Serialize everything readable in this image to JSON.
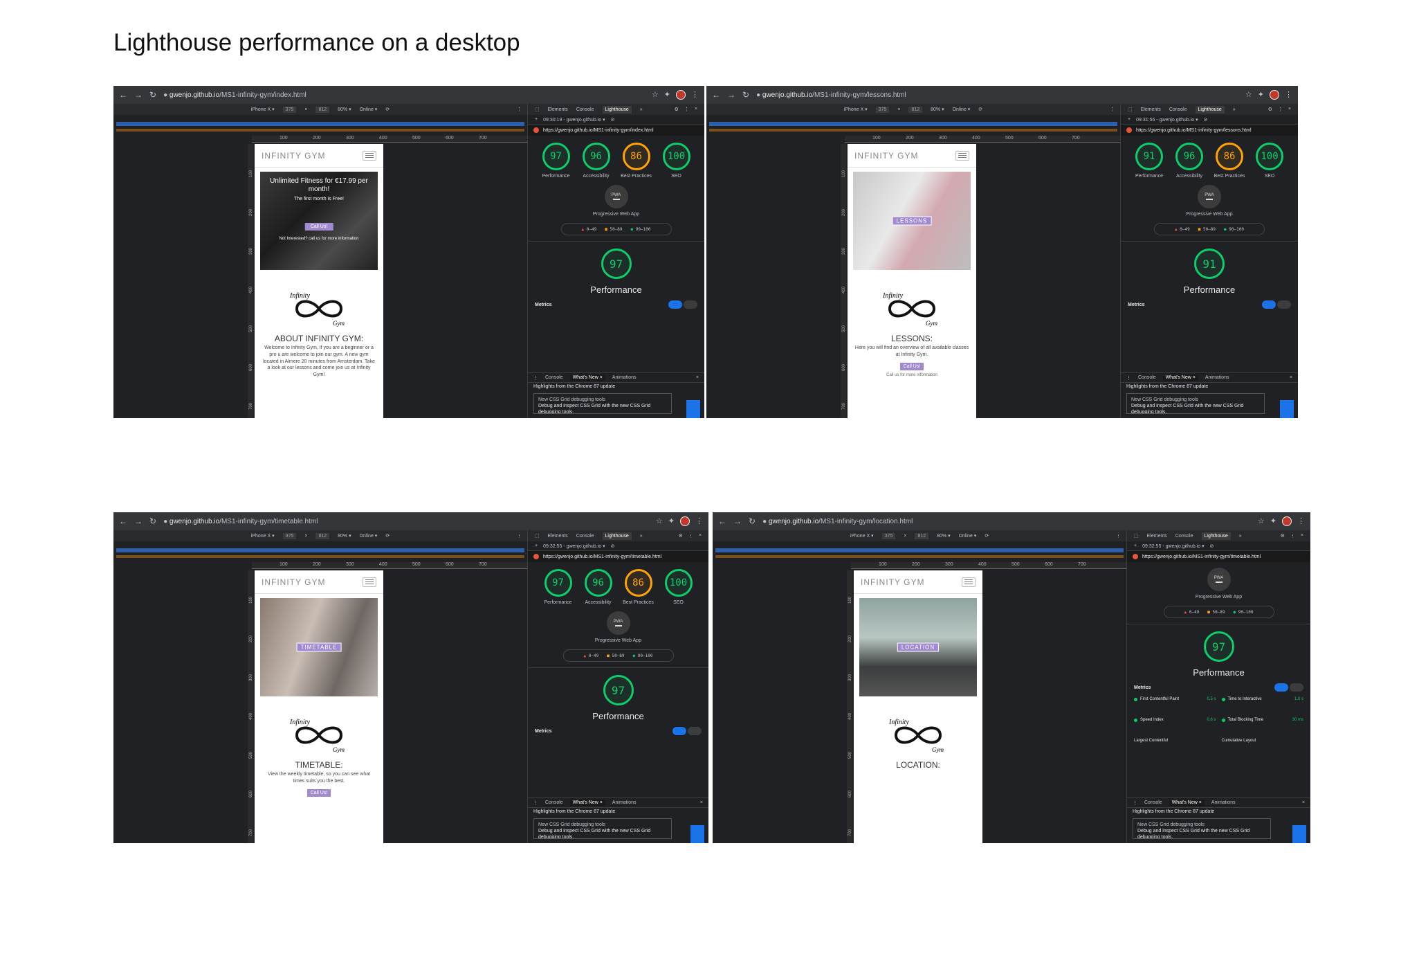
{
  "page_title": "Lighthouse performance on a desktop",
  "shots": [
    {
      "url_host": "gwenjo.github.io",
      "url_path": "/MS1-infinity-gym/index.html",
      "device": "iPhone X ▾",
      "width": "375",
      "height": "812",
      "zoom": "80% ▾",
      "network": "Online ▾",
      "run_time": "09:30:19 - gwenjo.github.io ▾",
      "report_url": "https://gwenjo.github.io/MS1-infinity-gym/index.html",
      "brand": "INFINITY GYM",
      "hero_title": "Unlimited Fitness for €17.99 per month!",
      "hero_sub": "The first month is Free!",
      "hero_btn": "Call Us!",
      "hero_foot": "Not Interested? call us for more information",
      "section_title": "ABOUT INFINITY GYM:",
      "section_body": "Welcome to Infinity Gym, If you are a beginner or a pro u are welcome to join our gym. A new gym located in Almere 20 minutes from Amsterdam. Take a look at our lessons and come join us at Infinity Gym!",
      "scores": [
        {
          "value": "97",
          "label": "Performance",
          "status": "good"
        },
        {
          "value": "96",
          "label": "Accessibility",
          "status": "good"
        },
        {
          "value": "86",
          "label": "Best Practices",
          "status": "avg"
        },
        {
          "value": "100",
          "label": "SEO",
          "status": "good"
        }
      ],
      "perf_score": "97"
    },
    {
      "url_host": "gwenjo.github.io",
      "url_path": "/MS1-infinity-gym/lessons.html",
      "device": "iPhone X ▾",
      "width": "375",
      "height": "812",
      "zoom": "80% ▾",
      "network": "Online ▾",
      "run_time": "09:31:56 - gwenjo.github.io ▾",
      "report_url": "https://gwenjo.github.io/MS1-infinity-gym/lessons.html",
      "brand": "INFINITY GYM",
      "hero_badge": "LESSONS",
      "section_title": "LESSONS:",
      "section_body": "Here you will find an overview of all available classes at Infinity Gym.",
      "section_btn": "Call Us!",
      "section_foot": "Call us for more information",
      "scores": [
        {
          "value": "91",
          "label": "Performance",
          "status": "good"
        },
        {
          "value": "96",
          "label": "Accessibility",
          "status": "good"
        },
        {
          "value": "86",
          "label": "Best Practices",
          "status": "avg"
        },
        {
          "value": "100",
          "label": "SEO",
          "status": "good"
        }
      ],
      "perf_score": "91"
    },
    {
      "url_host": "gwenjo.github.io",
      "url_path": "/MS1-infinity-gym/timetable.html",
      "device": "iPhone X ▾",
      "width": "375",
      "height": "812",
      "zoom": "80% ▾",
      "network": "Online ▾",
      "run_time": "09:32:55 - gwenjo.github.io ▾",
      "report_url": "https://gwenjo.github.io/MS1-infinity-gym/timetable.html",
      "brand": "INFINITY GYM",
      "hero_badge": "TIMETABLE",
      "section_title": "TIMETABLE:",
      "section_body": "View the weekly timetable, so you can see what times suits you the best.",
      "section_btn": "Call Us!",
      "scores": [
        {
          "value": "97",
          "label": "Performance",
          "status": "good"
        },
        {
          "value": "96",
          "label": "Accessibility",
          "status": "good"
        },
        {
          "value": "86",
          "label": "Best Practices",
          "status": "avg"
        },
        {
          "value": "100",
          "label": "SEO",
          "status": "good"
        }
      ],
      "perf_score": "97"
    },
    {
      "url_host": "gwenjo.github.io",
      "url_path": "/MS1-infinity-gym/location.html",
      "device": "iPhone X ▾",
      "width": "375",
      "height": "812",
      "zoom": "80% ▾",
      "network": "Online ▾",
      "run_time": "09:32:55 - gwenjo.github.io ▾",
      "report_url": "https://gwenjo.github.io/MS1-infinity-gym/timetable.html",
      "brand": "INFINITY GYM",
      "hero_badge": "LOCATION",
      "section_title": "LOCATION:",
      "perf_score": "97",
      "metrics": [
        {
          "label": "First Contentful Paint",
          "value": "0.5 s"
        },
        {
          "label": "Time to Interactive",
          "value": "1.0 s"
        },
        {
          "label": "Speed Index",
          "value": "0.6 s"
        },
        {
          "label": "Total Blocking Time",
          "value": "30 ms"
        },
        {
          "label": "Largest Contentful",
          "value": ""
        },
        {
          "label": "Cumulative Layout",
          "value": ""
        }
      ]
    }
  ],
  "common": {
    "tab_elements": "Elements",
    "tab_console": "Console",
    "tab_lighthouse": "Lighthouse",
    "tab_more": "»",
    "pwa_icon_text": "PWA",
    "pwa_label": "Progressive Web App",
    "legend_fail": "0–49",
    "legend_avg": "50–89",
    "legend_pass": "90–100",
    "perf_label": "Performance",
    "metrics_label": "Metrics",
    "drawer_console": "Console",
    "drawer_whatsnew": "What's New ×",
    "drawer_animations": "Animations",
    "drawer_highlights": "Highlights from the Chrome 87 update",
    "card_title": "New CSS Grid debugging tools",
    "card_body": "Debug and inspect CSS Grid with the new CSS Grid debugging tools.",
    "logo_top": "Infinity",
    "logo_bottom": "Gym",
    "ruler": [
      "100",
      "200",
      "300",
      "400",
      "500",
      "600",
      "700"
    ],
    "colors": {
      "pass": "#0cce6b",
      "average": "#ffa400",
      "fail": "#ff4e42",
      "accent": "#a28ad0"
    }
  }
}
